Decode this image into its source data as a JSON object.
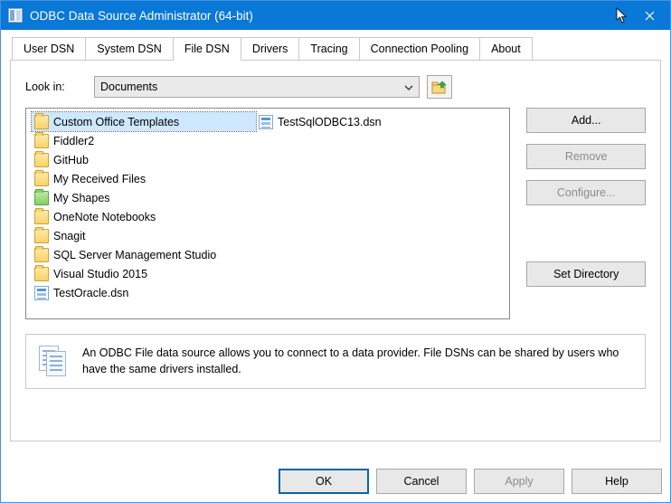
{
  "window": {
    "title": "ODBC Data Source Administrator (64-bit)"
  },
  "tabs": [
    {
      "label": "User DSN"
    },
    {
      "label": "System DSN"
    },
    {
      "label": "File DSN"
    },
    {
      "label": "Drivers"
    },
    {
      "label": "Tracing"
    },
    {
      "label": "Connection Pooling"
    },
    {
      "label": "About"
    }
  ],
  "active_tab": "File DSN",
  "lookin": {
    "label": "Look in:",
    "value": "Documents"
  },
  "filelist": {
    "folders": [
      {
        "label": "Custom Office Templates",
        "selected": true,
        "special": false
      },
      {
        "label": "Fiddler2",
        "selected": false,
        "special": false
      },
      {
        "label": "GitHub",
        "selected": false,
        "special": false
      },
      {
        "label": "My Received Files",
        "selected": false,
        "special": false
      },
      {
        "label": "My Shapes",
        "selected": false,
        "special": true
      },
      {
        "label": "OneNote Notebooks",
        "selected": false,
        "special": false
      },
      {
        "label": "Snagit",
        "selected": false,
        "special": false
      },
      {
        "label": "SQL Server Management Studio",
        "selected": false,
        "special": false
      },
      {
        "label": "Visual Studio 2015",
        "selected": false,
        "special": false
      }
    ],
    "files": [
      {
        "label": "TestOracle.dsn"
      },
      {
        "label": "TestSqlODBC13.dsn"
      }
    ]
  },
  "side_buttons": {
    "add": "Add...",
    "remove": "Remove",
    "configure": "Configure...",
    "set_directory": "Set Directory"
  },
  "info_text": "An ODBC File data source allows you to connect to a data provider.  File DSNs can be shared by users who have the same drivers installed.",
  "bottom_buttons": {
    "ok": "OK",
    "cancel": "Cancel",
    "apply": "Apply",
    "help": "Help"
  }
}
